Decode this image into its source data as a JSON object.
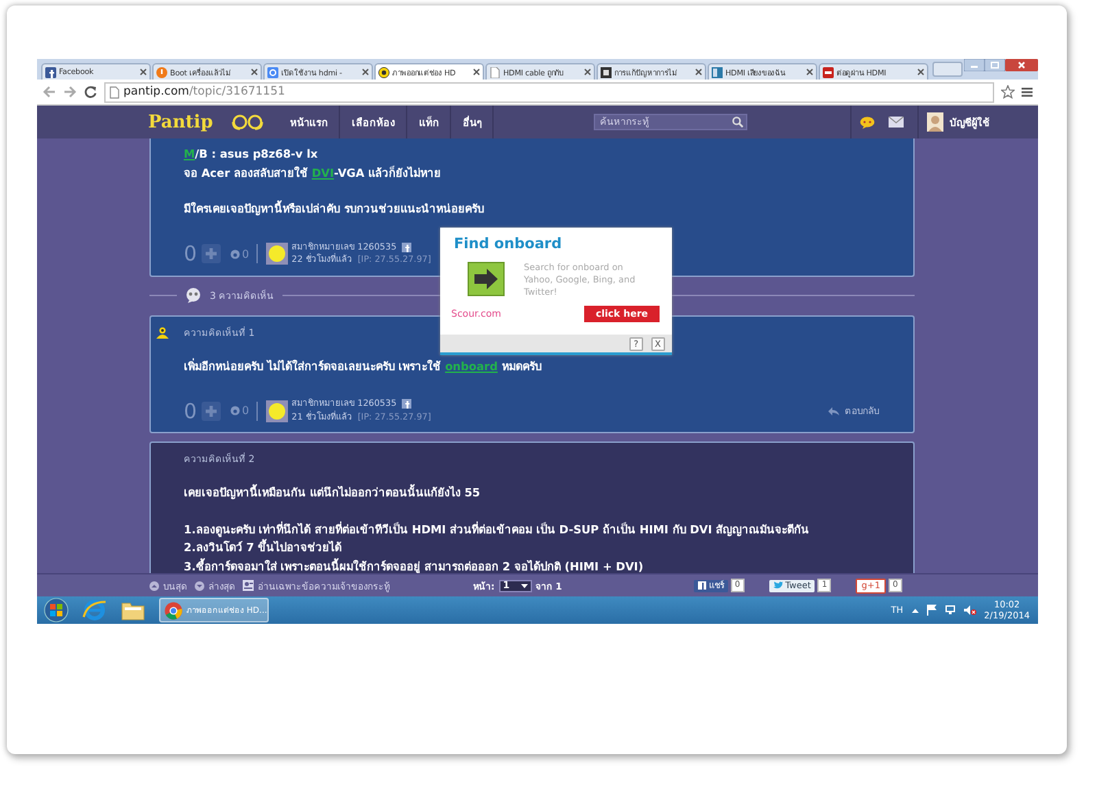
{
  "browser": {
    "tabs": [
      {
        "title": "Facebook",
        "selected": false
      },
      {
        "title": "Boot เครื่องแล้วไม่",
        "selected": false
      },
      {
        "title": "เปิดใช้งาน hdmi -",
        "selected": false
      },
      {
        "title": "ภาพออกแต่ช่อง HD",
        "selected": true
      },
      {
        "title": "HDMI cable ถูกกับ",
        "selected": false
      },
      {
        "title": "การแก้ปัญหาการไม่",
        "selected": false
      },
      {
        "title": "HDMI เสียงของฉัน",
        "selected": false
      },
      {
        "title": "ต่อดูผ่าน HDMI",
        "selected": false
      }
    ],
    "address": {
      "host": "pantip.com",
      "path": "/topic/31671151"
    }
  },
  "site_header": {
    "logo": "Pantip",
    "nav": [
      "หน้าแรก",
      "เลือกห้อง",
      "แท็ก",
      "อื่นๆ"
    ],
    "search": {
      "placeholder": "ค้นหากระทู้"
    },
    "account": "บัญชีผู้ใช้"
  },
  "topic": {
    "paragraphs": [
      {
        "lines": [
          [
            {
              "text": "M",
              "link": true
            },
            {
              "text": "/B : asus p8z68-v lx",
              "link": false
            }
          ],
          [
            {
              "text": "จอ Acer ลองสลับสายใช้ ",
              "link": false
            },
            {
              "text": "DVI",
              "link": true
            },
            {
              "text": "-VGA แล้วก็ยังไม่หาย",
              "link": false
            }
          ]
        ]
      },
      {
        "lines": [
          [
            {
              "text": "มีใครเคยเจอปัญหานี้หรือเปล่าคับ รบกวนช่วยแนะนำหน่อยครับ",
              "link": false
            }
          ]
        ]
      }
    ],
    "footer": {
      "votes": "0",
      "emotions": "0",
      "member": "สมาชิกหมายเลข 1260535",
      "time": "22 ชั่วโมงที่แล้ว",
      "ip": "[IP: 27.55.27.97]"
    }
  },
  "comment_count": "3 ความคิดเห็น",
  "comments": [
    {
      "label": "ความคิดเห็นที่ 1",
      "owner": true,
      "paragraphs": [
        {
          "lines": [
            [
              {
                "text": "เพิ่มอีกหน่อยครับ ไม่ได้ใส่การ์ดจอเลยนะครับ เพราะใช้ ",
                "link": false
              },
              {
                "text": "onboard",
                "link": true
              },
              {
                "text": " หมดครับ",
                "link": false
              }
            ]
          ]
        }
      ],
      "footer": {
        "votes": "0",
        "emotions": "0",
        "member": "สมาชิกหมายเลข 1260535",
        "time": "21 ชั่วโมงที่แล้ว",
        "ip": "[IP: 27.55.27.97]",
        "reply": "ตอบกลับ"
      }
    },
    {
      "label": "ความคิดเห็นที่ 2",
      "owner": false,
      "paragraphs": [
        {
          "lines": [
            [
              {
                "text": "เคยเจอปัญหานี้เหมือนกัน แต่นึกไม่ออกว่าตอนนั้นแก้ยังไง 55",
                "link": false
              }
            ]
          ]
        },
        {
          "lines": [
            [
              {
                "text": "1.ลองดูนะครับ เท่าที่นึกได้ สายที่ต่อเข้าทีวีเป็น HDMI ส่วนที่ต่อเข้าคอม เป็น D-SUP ถ้าเป็น HIMI กับ DVI สัญญาณมันจะตีกัน",
                "link": false
              }
            ],
            [
              {
                "text": "2.ลงวินโดว์ 7 ขึ้นไปอาจช่วยได้",
                "link": false
              }
            ],
            [
              {
                "text": "3.ซื้อการ์ดจอมาใส่ เพราะตอนนี้ผมใช้การ์ดจออยู่ สามารถต่อออก 2 จอได้ปกติ  (HIMI + DVI)",
                "link": false
              }
            ]
          ]
        }
      ]
    }
  ],
  "ad": {
    "title": "Find onboard",
    "text": "Search for onboard on Yahoo, Google, Bing, and Twitter!",
    "source": "Scour.com",
    "button": "click here",
    "help": "?",
    "close": "X"
  },
  "bottom_bar": {
    "top": "บนสุด",
    "bottom": "ล่างสุด",
    "owner_only": "อ่านเฉพาะข้อความเจ้าของกระทู้",
    "page_label": "หน้า:",
    "page": "1",
    "of": "จาก 1",
    "share": "แชร์",
    "share_count": "0",
    "tweet": "Tweet",
    "tweet_count": "1",
    "plus": "g+1",
    "plus_count": "0"
  },
  "taskbar": {
    "task": "ภาพออกแต่ช่อง HD...",
    "language": "TH",
    "time": "10:02",
    "date": "2/19/2014"
  }
}
